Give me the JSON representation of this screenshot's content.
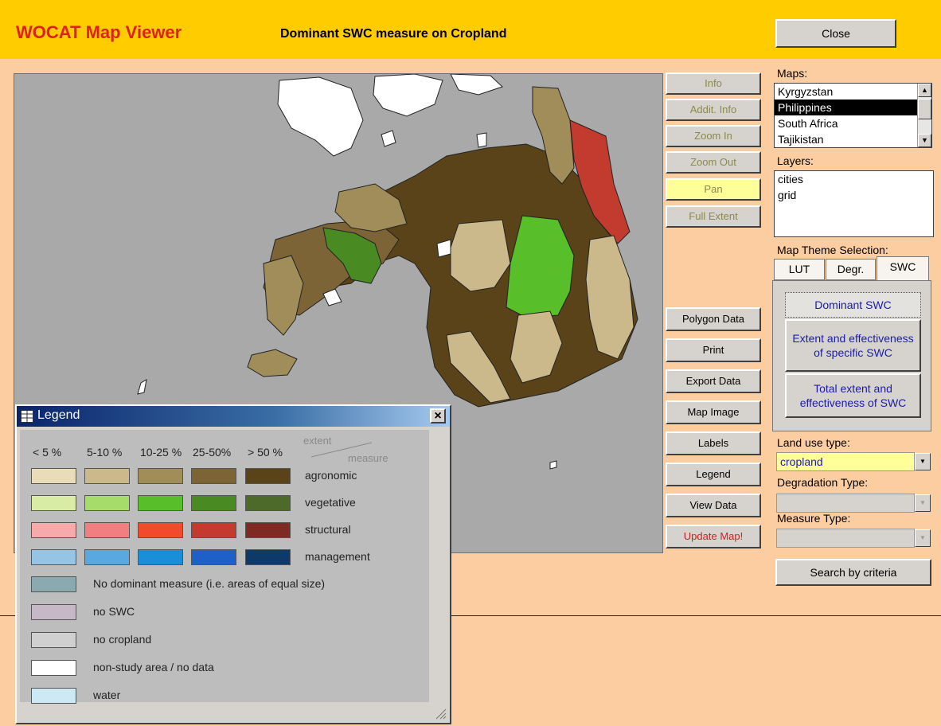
{
  "header": {
    "app_title": "WOCAT Map Viewer",
    "map_title": "Dominant SWC measure on Cropland",
    "close_label": "Close"
  },
  "toolbar": {
    "info": "Info",
    "addit_info": "Addit. Info",
    "zoom_in": "Zoom In",
    "zoom_out": "Zoom Out",
    "pan": "Pan",
    "full_extent": "Full Extent",
    "polygon_data": "Polygon Data",
    "print": "Print",
    "export_data": "Export Data",
    "map_image": "Map Image",
    "labels": "Labels",
    "legend": "Legend",
    "view_data": "View Data",
    "update_map": "Update Map!"
  },
  "maps": {
    "label": "Maps:",
    "items": [
      "Kyrgyzstan",
      "Philippines",
      "South Africa",
      "Tajikistan"
    ],
    "selected": "Philippines"
  },
  "layers": {
    "label": "Layers:",
    "items": [
      "cities",
      "grid"
    ]
  },
  "theme": {
    "label": "Map Theme Selection:",
    "tabs": [
      "LUT",
      "Degr.",
      "SWC"
    ],
    "active_tab": "SWC",
    "buttons": [
      "Dominant SWC",
      "Extent and effectiveness of specific SWC",
      "Total extent and effectiveness of SWC"
    ]
  },
  "filters": {
    "land_use_label": "Land use type:",
    "land_use_value": "cropland",
    "degradation_label": "Degradation Type:",
    "degradation_value": "",
    "measure_label": "Measure Type:",
    "measure_value": "",
    "search_label": "Search by criteria"
  },
  "legend": {
    "title": "Legend",
    "close": "×",
    "extent_label": "extent",
    "measure_label": "measure",
    "columns": [
      "< 5 %",
      "5-10 %",
      "10-25 %",
      "25-50%",
      "> 50 %"
    ],
    "rows": [
      {
        "label": "agronomic",
        "colors": [
          "#E8DDB8",
          "#CBB98C",
          "#A18D59",
          "#7C6437",
          "#5A4318"
        ]
      },
      {
        "label": "vegetative",
        "colors": [
          "#D8ECA6",
          "#A5DC6A",
          "#58BE2A",
          "#4A8A22",
          "#4E6A2A"
        ]
      },
      {
        "label": "structural",
        "colors": [
          "#F6AAAA",
          "#F08080",
          "#F24A2C",
          "#C33A2E",
          "#7E2A22"
        ]
      },
      {
        "label": "management",
        "colors": [
          "#96C4E4",
          "#5AA8E0",
          "#1A8ED8",
          "#1E60C8",
          "#0E3A6A"
        ]
      }
    ],
    "singles": [
      {
        "label": "No dominant measure (i.e. areas of equal size)",
        "color": "#8AAAB0"
      },
      {
        "label": "no SWC",
        "color": "#C6B8C6"
      },
      {
        "label": "no cropland",
        "color": "#D0D0D0"
      },
      {
        "label": "non-study area / no data",
        "color": "#FFFFFF"
      },
      {
        "label": "water",
        "color": "#CDE9F4"
      }
    ]
  }
}
